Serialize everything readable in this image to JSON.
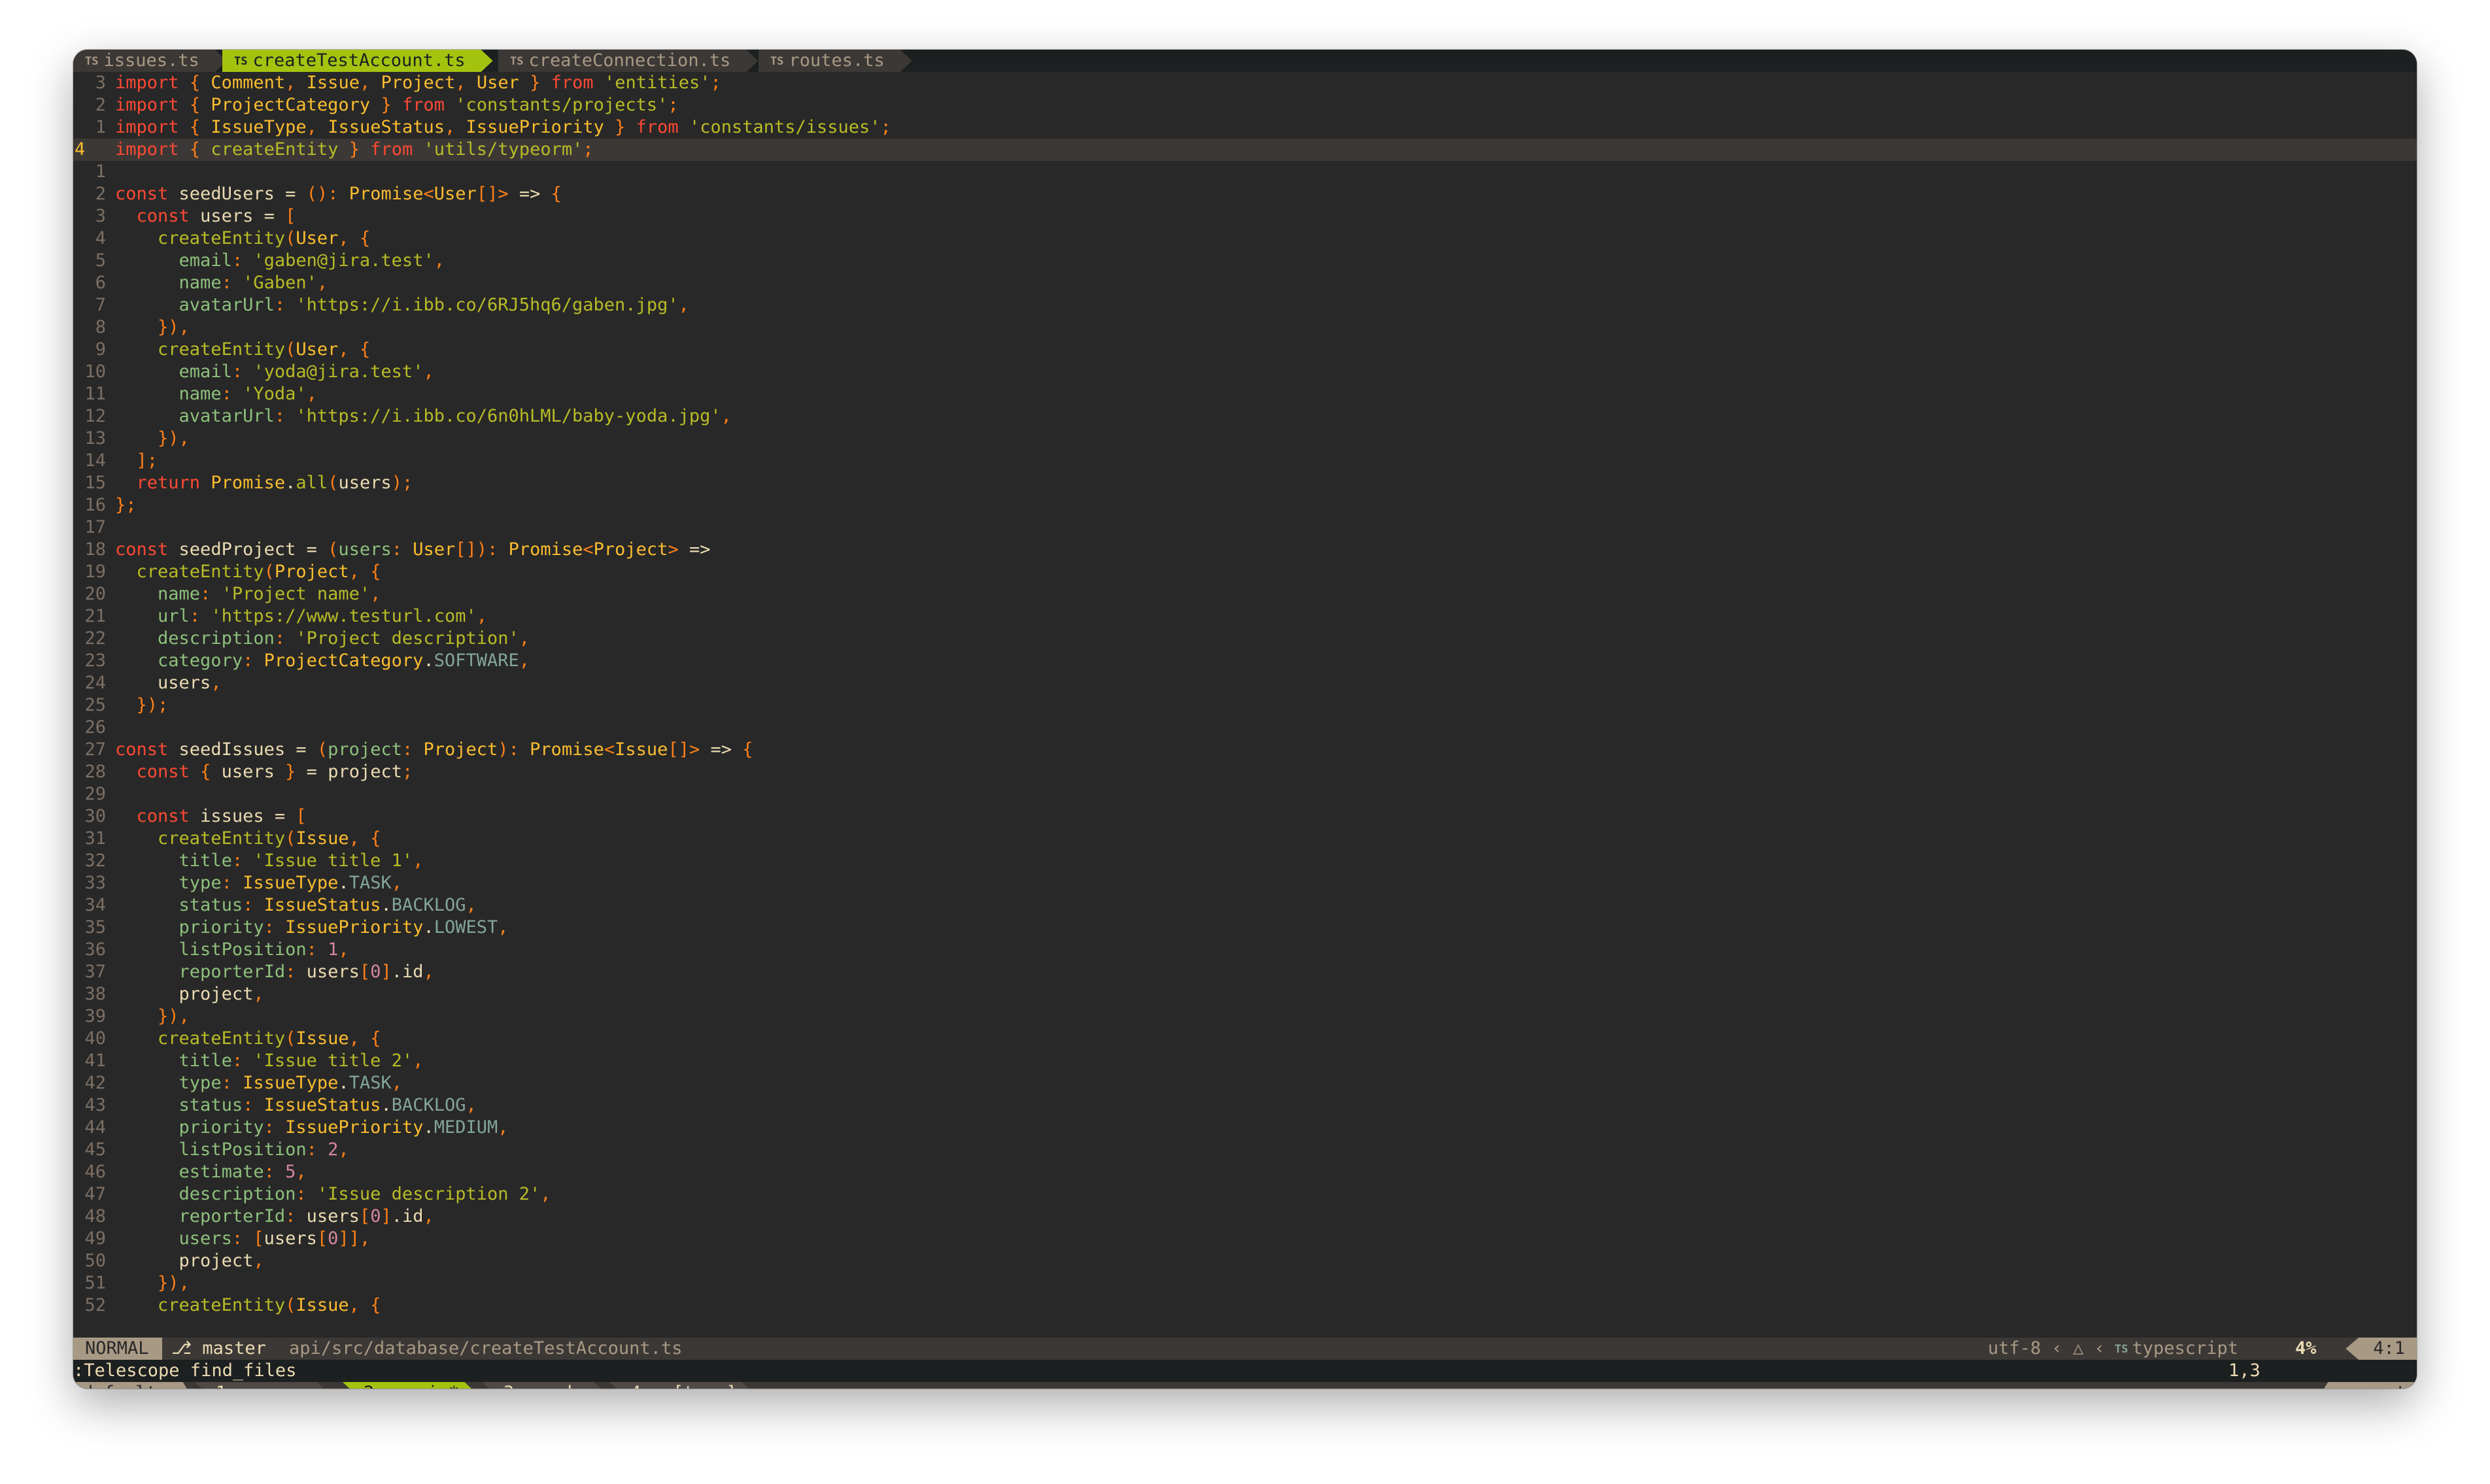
{
  "tabs": [
    {
      "icon": "TS",
      "label": "issues.ts",
      "active": false
    },
    {
      "icon": "TS",
      "label": "createTestAccount.ts",
      "active": true
    },
    {
      "icon": "TS",
      "label": "createConnection.ts",
      "active": false
    },
    {
      "icon": "TS",
      "label": "routes.ts",
      "active": false
    }
  ],
  "lines": [
    {
      "n": "3",
      "cur": false,
      "text": "import { Comment, Issue, Project, User } from 'entities';"
    },
    {
      "n": "2",
      "cur": false,
      "text": "import { ProjectCategory } from 'constants/projects';"
    },
    {
      "n": "1",
      "cur": false,
      "text": "import { IssueType, IssueStatus, IssuePriority } from 'constants/issues';"
    },
    {
      "n": "4",
      "cur": true,
      "text": "import { createEntity } from 'utils/typeorm';"
    },
    {
      "n": "1",
      "cur": false,
      "text": ""
    },
    {
      "n": "2",
      "cur": false,
      "text": "const seedUsers = (): Promise<User[]> => {"
    },
    {
      "n": "3",
      "cur": false,
      "text": "  const users = ["
    },
    {
      "n": "4",
      "cur": false,
      "text": "    createEntity(User, {"
    },
    {
      "n": "5",
      "cur": false,
      "text": "      email: 'gaben@jira.test',"
    },
    {
      "n": "6",
      "cur": false,
      "text": "      name: 'Gaben',"
    },
    {
      "n": "7",
      "cur": false,
      "text": "      avatarUrl: 'https://i.ibb.co/6RJ5hq6/gaben.jpg',"
    },
    {
      "n": "8",
      "cur": false,
      "text": "    }),"
    },
    {
      "n": "9",
      "cur": false,
      "text": "    createEntity(User, {"
    },
    {
      "n": "10",
      "cur": false,
      "text": "      email: 'yoda@jira.test',"
    },
    {
      "n": "11",
      "cur": false,
      "text": "      name: 'Yoda',"
    },
    {
      "n": "12",
      "cur": false,
      "text": "      avatarUrl: 'https://i.ibb.co/6n0hLML/baby-yoda.jpg',"
    },
    {
      "n": "13",
      "cur": false,
      "text": "    }),"
    },
    {
      "n": "14",
      "cur": false,
      "text": "  ];"
    },
    {
      "n": "15",
      "cur": false,
      "text": "  return Promise.all(users);"
    },
    {
      "n": "16",
      "cur": false,
      "text": "};"
    },
    {
      "n": "17",
      "cur": false,
      "text": ""
    },
    {
      "n": "18",
      "cur": false,
      "text": "const seedProject = (users: User[]): Promise<Project> =>"
    },
    {
      "n": "19",
      "cur": false,
      "text": "  createEntity(Project, {"
    },
    {
      "n": "20",
      "cur": false,
      "text": "    name: 'Project name',"
    },
    {
      "n": "21",
      "cur": false,
      "text": "    url: 'https://www.testurl.com',"
    },
    {
      "n": "22",
      "cur": false,
      "text": "    description: 'Project description',"
    },
    {
      "n": "23",
      "cur": false,
      "text": "    category: ProjectCategory.SOFTWARE,"
    },
    {
      "n": "24",
      "cur": false,
      "text": "    users,"
    },
    {
      "n": "25",
      "cur": false,
      "text": "  });"
    },
    {
      "n": "26",
      "cur": false,
      "text": ""
    },
    {
      "n": "27",
      "cur": false,
      "text": "const seedIssues = (project: Project): Promise<Issue[]> => {"
    },
    {
      "n": "28",
      "cur": false,
      "text": "  const { users } = project;"
    },
    {
      "n": "29",
      "cur": false,
      "text": ""
    },
    {
      "n": "30",
      "cur": false,
      "text": "  const issues = ["
    },
    {
      "n": "31",
      "cur": false,
      "text": "    createEntity(Issue, {"
    },
    {
      "n": "32",
      "cur": false,
      "text": "      title: 'Issue title 1',"
    },
    {
      "n": "33",
      "cur": false,
      "text": "      type: IssueType.TASK,"
    },
    {
      "n": "34",
      "cur": false,
      "text": "      status: IssueStatus.BACKLOG,"
    },
    {
      "n": "35",
      "cur": false,
      "text": "      priority: IssuePriority.LOWEST,"
    },
    {
      "n": "36",
      "cur": false,
      "text": "      listPosition: 1,"
    },
    {
      "n": "37",
      "cur": false,
      "text": "      reporterId: users[0].id,"
    },
    {
      "n": "38",
      "cur": false,
      "text": "      project,"
    },
    {
      "n": "39",
      "cur": false,
      "text": "    }),"
    },
    {
      "n": "40",
      "cur": false,
      "text": "    createEntity(Issue, {"
    },
    {
      "n": "41",
      "cur": false,
      "text": "      title: 'Issue title 2',"
    },
    {
      "n": "42",
      "cur": false,
      "text": "      type: IssueType.TASK,"
    },
    {
      "n": "43",
      "cur": false,
      "text": "      status: IssueStatus.BACKLOG,"
    },
    {
      "n": "44",
      "cur": false,
      "text": "      priority: IssuePriority.MEDIUM,"
    },
    {
      "n": "45",
      "cur": false,
      "text": "      listPosition: 2,"
    },
    {
      "n": "46",
      "cur": false,
      "text": "      estimate: 5,"
    },
    {
      "n": "47",
      "cur": false,
      "text": "      description: 'Issue description 2',"
    },
    {
      "n": "48",
      "cur": false,
      "text": "      reporterId: users[0].id,"
    },
    {
      "n": "49",
      "cur": false,
      "text": "      users: [users[0]],"
    },
    {
      "n": "50",
      "cur": false,
      "text": "      project,"
    },
    {
      "n": "51",
      "cur": false,
      "text": "    }),"
    },
    {
      "n": "52",
      "cur": false,
      "text": "    createEntity(Issue, {"
    }
  ],
  "statusline": {
    "mode": "NORMAL",
    "branch_icon": "git-branch-icon",
    "branch": "master",
    "filepath": "api/src/database/createTestAccount.ts",
    "encoding": "utf-8",
    "os_icon": "linux-penguin-icon",
    "filetype_icon": "TS",
    "filetype": "typescript",
    "percent": "4%",
    "position": "4:1"
  },
  "cmdline": {
    "command": ":Telescope find_files",
    "ruler": "1,3"
  },
  "tmux": {
    "session": "default",
    "windows": [
      {
        "index": "1",
        "name": "procs",
        "active": false
      },
      {
        "index": "2",
        "name": "nvim*",
        "active": true
      },
      {
        "index": "3",
        "name": "zsh-",
        "active": false
      },
      {
        "index": "4",
        "name": "[tmux]",
        "active": false
      }
    ],
    "host": "zenput"
  },
  "colors": {
    "background": "#282828",
    "tab_active": "#a4c30f",
    "keyword": "#fb4934",
    "type": "#fabd2f",
    "string": "#b8bb26",
    "punctuation": "#fe8019",
    "property": "#8ec07c",
    "number": "#d3869b"
  }
}
